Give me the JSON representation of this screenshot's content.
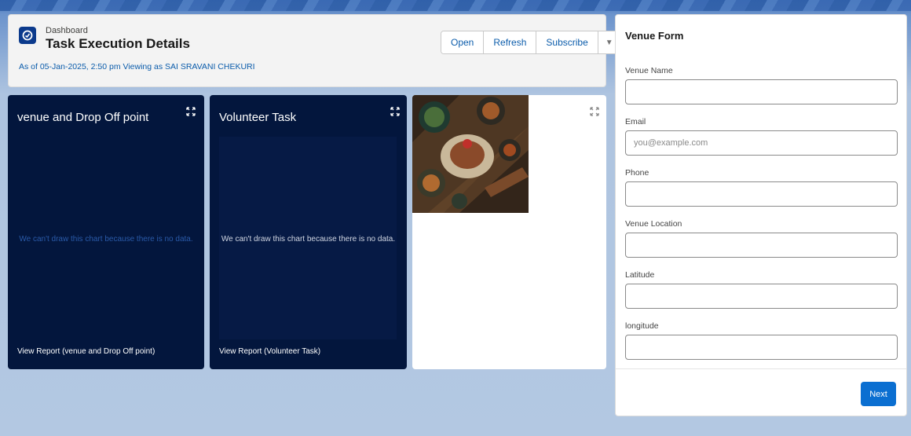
{
  "header": {
    "type_label": "Dashboard",
    "title": "Task Execution Details",
    "subtitle": "As of 05-Jan-2025, 2:50 pm Viewing as SAI SRAVANI CHEKURI",
    "buttons": {
      "open": "Open",
      "refresh": "Refresh",
      "subscribe": "Subscribe",
      "more": "▼"
    }
  },
  "tiles": [
    {
      "title": "venue and Drop Off point",
      "message": "We can't draw this chart because there is no data.",
      "footer": "View Report (venue and Drop Off point)"
    },
    {
      "title": "Volunteer Task",
      "message": "We can't draw this chart because there is no data.",
      "footer": "View Report (Volunteer Task)"
    },
    {
      "image_icon": "food-platter-image"
    }
  ],
  "form": {
    "title": "Venue Form",
    "fields": [
      {
        "label": "Venue Name",
        "value": "",
        "placeholder": ""
      },
      {
        "label": "Email",
        "value": "",
        "placeholder": "you@example.com"
      },
      {
        "label": "Phone",
        "value": "",
        "placeholder": ""
      },
      {
        "label": "Venue Location",
        "value": "",
        "placeholder": ""
      },
      {
        "label": "Latitude",
        "value": "",
        "placeholder": ""
      },
      {
        "label": "longitude",
        "value": "",
        "placeholder": ""
      }
    ],
    "next_label": "Next"
  },
  "colors": {
    "accent": "#0b5cab",
    "tile_dark": "#03163d",
    "primary_button": "#0b6fd1",
    "nodata_dim": "#2a5aa8"
  }
}
